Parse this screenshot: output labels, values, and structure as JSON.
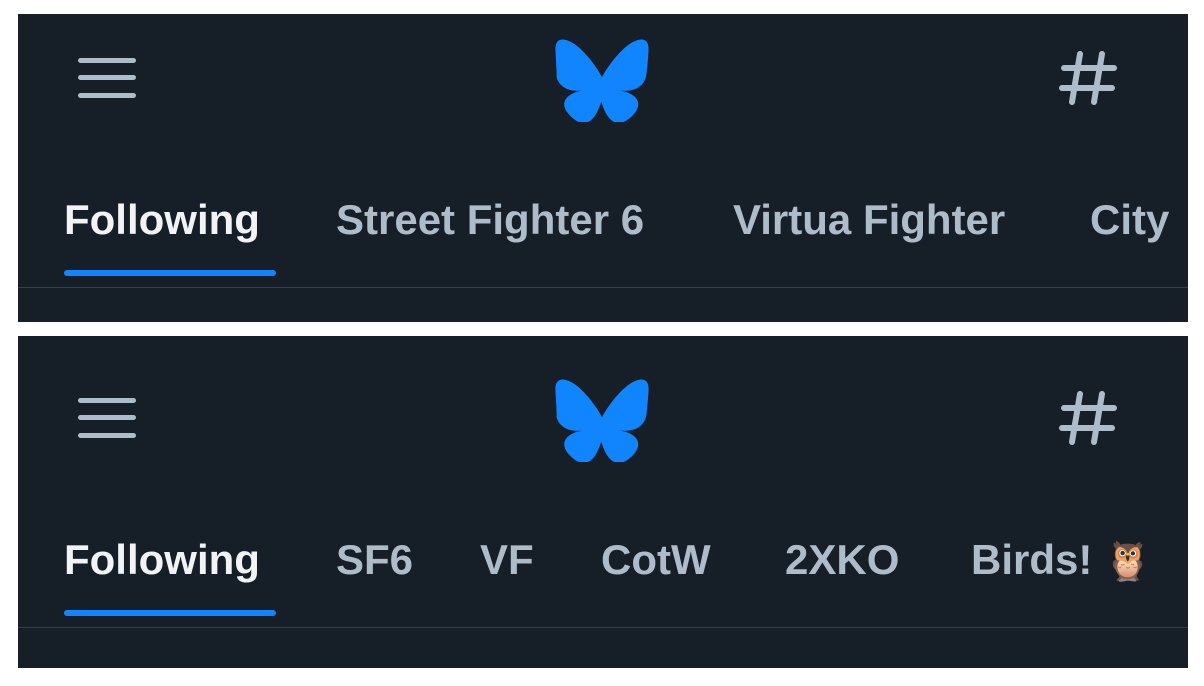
{
  "colors": {
    "background": "#161e27",
    "accent": "#1185fe",
    "active_tab_text": "#f1f3f5",
    "inactive_tab_text": "#aebbc9",
    "divider": "#2e4052"
  },
  "panels": [
    {
      "header": {
        "menu_icon": "hamburger-menu-icon",
        "logo_icon": "bluesky-butterfly-icon",
        "feeds_icon": "hashtag-icon"
      },
      "tabs": [
        {
          "label": "Following",
          "active": true
        },
        {
          "label": "Street Fighter 6",
          "active": false
        },
        {
          "label": "Virtua Fighter",
          "active": false
        },
        {
          "label": "City",
          "active": false
        }
      ]
    },
    {
      "header": {
        "menu_icon": "hamburger-menu-icon",
        "logo_icon": "bluesky-butterfly-icon",
        "feeds_icon": "hashtag-icon"
      },
      "tabs": [
        {
          "label": "Following",
          "active": true
        },
        {
          "label": "SF6",
          "active": false
        },
        {
          "label": "VF",
          "active": false
        },
        {
          "label": "CotW",
          "active": false
        },
        {
          "label": "2XKO",
          "active": false
        },
        {
          "label": "Birds!",
          "active": false,
          "emoji": "🦉"
        }
      ]
    }
  ]
}
